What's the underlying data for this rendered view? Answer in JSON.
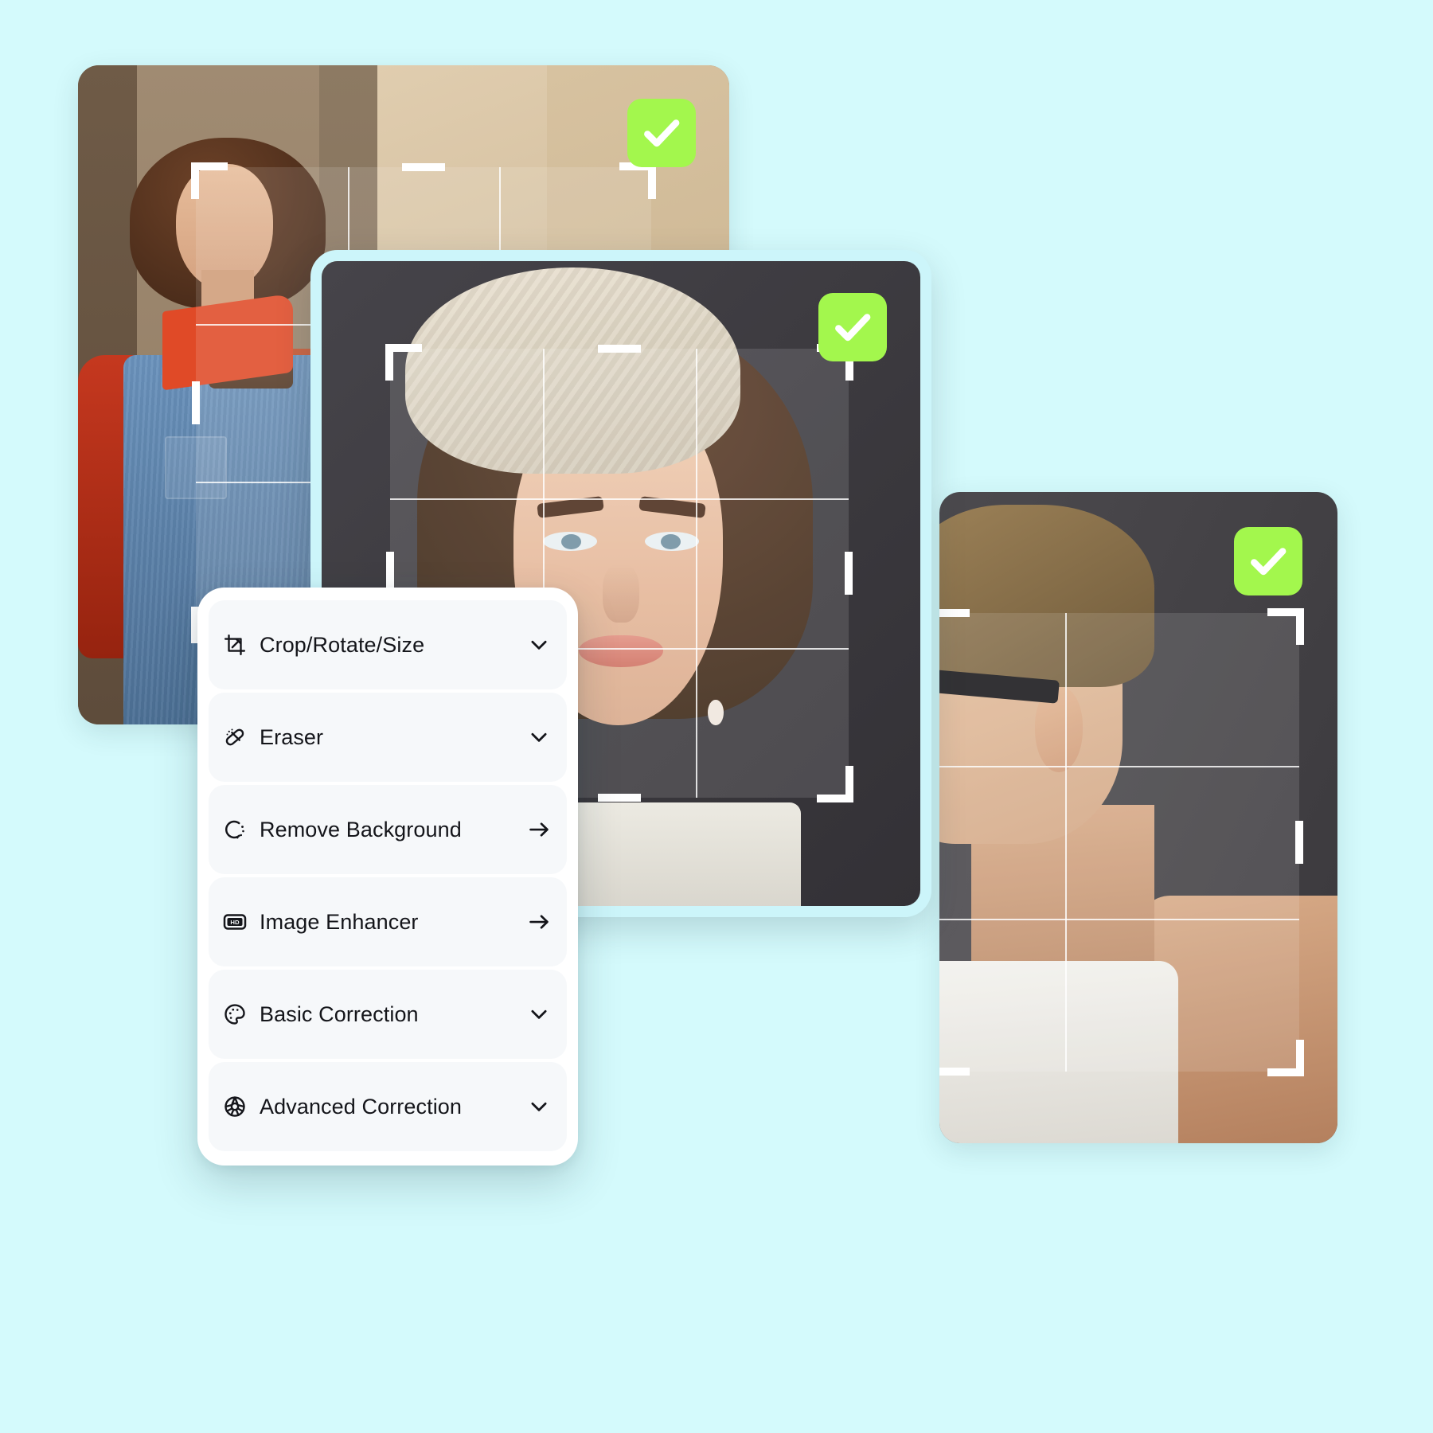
{
  "theme": {
    "page_background": "#d4fafc",
    "card_border": "#ccf5fa",
    "badge_green": "#a3f74d",
    "menu_panel_background": "#ffffff",
    "menu_row_background": "#f6f8fa",
    "text_color": "#14151a"
  },
  "cards": [
    {
      "name": "woman-denim-jacket",
      "status_badge": "verified-check",
      "crop_overlay": "rule-of-thirds"
    },
    {
      "name": "woman-lace-headband",
      "status_badge": "verified-check",
      "crop_overlay": "rule-of-thirds"
    },
    {
      "name": "man-tank-top",
      "status_badge": "verified-check",
      "crop_overlay": "rule-of-thirds"
    }
  ],
  "tool_menu": {
    "items": [
      {
        "label": "Crop/Rotate/Size",
        "icon": "crop-icon",
        "action": "chevron-down-icon"
      },
      {
        "label": "Eraser",
        "icon": "eraser-icon",
        "action": "chevron-down-icon"
      },
      {
        "label": "Remove Background",
        "icon": "remove-background-icon",
        "action": "arrow-right-icon"
      },
      {
        "label": "Image Enhancer",
        "icon": "hd-badge-icon",
        "action": "arrow-right-icon"
      },
      {
        "label": "Basic Correction",
        "icon": "palette-icon",
        "action": "chevron-down-icon"
      },
      {
        "label": "Advanced Correction",
        "icon": "color-wheel-icon",
        "action": "chevron-down-icon"
      }
    ]
  }
}
